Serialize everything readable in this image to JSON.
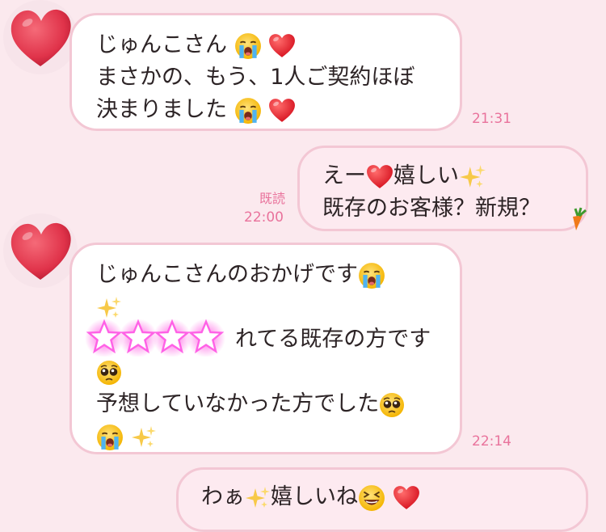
{
  "messages": [
    {
      "id": "m1",
      "side": "in",
      "lines": [
        "じゅんこさん",
        "まさかの、もう、1人ご契約ほぼ",
        "決まりました"
      ],
      "time": "21:31"
    },
    {
      "id": "m2",
      "side": "out",
      "lines": [
        "えー",
        "嬉しい",
        "既存のお客様？新規？"
      ],
      "time": "22:00",
      "read": "既読"
    },
    {
      "id": "m3",
      "side": "in",
      "lines": [
        "じゅんこさんのおかげです",
        "",
        "れてる既存の方です",
        "",
        "予想していなかった方でした",
        ""
      ],
      "time": "22:14"
    },
    {
      "id": "m4",
      "side": "out",
      "lines": [
        "わぁ",
        "嬉しいね"
      ]
    }
  ],
  "icons": [
    "heart-avatar-icon",
    "crying-face-icon",
    "red-heart-icon",
    "sparkles-icon",
    "pleading-face-icon",
    "grinning-squint-face-icon",
    "carrot-icon",
    "star-sticker-icon"
  ],
  "colors": {
    "background": "#fbe9ee",
    "bubble_border": "#f3c7d4",
    "time": "#e9739c",
    "outgoing_bubble": "#fdeaf0",
    "incoming_bubble": "#ffffff"
  }
}
